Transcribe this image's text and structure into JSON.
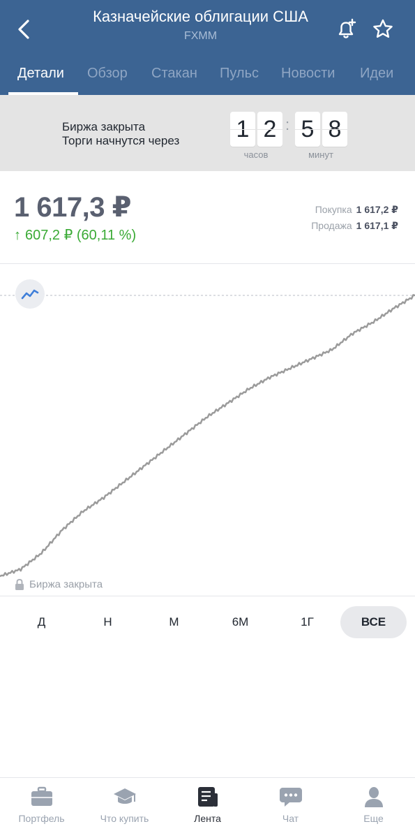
{
  "header": {
    "title": "Казначейские облигации США",
    "ticker": "FXMM"
  },
  "tabs": [
    {
      "label": "Детали",
      "active": true
    },
    {
      "label": "Обзор"
    },
    {
      "label": "Стакан"
    },
    {
      "label": "Пульс"
    },
    {
      "label": "Новости"
    },
    {
      "label": "Идеи"
    }
  ],
  "status": {
    "line1": "Биржа закрыта",
    "line2": "Торги начнутся через",
    "hours_digits": [
      "1",
      "2"
    ],
    "minutes_digits": [
      "5",
      "8"
    ],
    "hours_label": "часов",
    "minutes_label": "минут"
  },
  "price": {
    "value": "1 617,3 ₽",
    "change": "607,2 ₽ (60,11 %)",
    "change_arrow": "↑",
    "buy_label": "Покупка",
    "buy_value": "1 617,2 ₽",
    "sell_label": "Продажа",
    "sell_value": "1 617,1 ₽"
  },
  "chart_note": "Биржа закрыта",
  "chart_data": {
    "type": "line",
    "series_color": "#9b9b9b",
    "reference_line": "dashed at current price",
    "values": [
      1010,
      1025,
      1060,
      1110,
      1150,
      1180,
      1215,
      1250,
      1285,
      1320,
      1355,
      1385,
      1415,
      1440,
      1460,
      1480,
      1500,
      1535,
      1560,
      1590,
      1617.3
    ]
  },
  "periods": [
    {
      "label": "Д"
    },
    {
      "label": "Н"
    },
    {
      "label": "М"
    },
    {
      "label": "6М"
    },
    {
      "label": "1Г"
    },
    {
      "label": "ВСЕ",
      "active": true
    }
  ],
  "bottom_nav": [
    {
      "label": "Портфель",
      "icon": "briefcase-icon"
    },
    {
      "label": "Что купить",
      "icon": "graduation-cap-icon"
    },
    {
      "label": "Лента",
      "icon": "news-feed-icon",
      "active": true
    },
    {
      "label": "Чат",
      "icon": "chat-bubble-icon"
    },
    {
      "label": "Еще",
      "icon": "person-icon"
    }
  ],
  "colors": {
    "header": "#3c6493",
    "positive": "#3aaa35",
    "banner": "#e4e4e4"
  }
}
